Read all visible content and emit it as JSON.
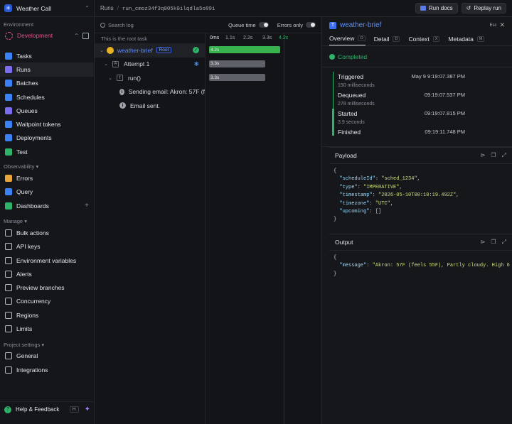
{
  "project": {
    "name": "Weather Call"
  },
  "environment": {
    "section_label": "Environment",
    "name": "Development"
  },
  "nav_main": [
    {
      "label": "Tasks",
      "icon": "tasks-icon",
      "color": "#3b82f6"
    },
    {
      "label": "Runs",
      "icon": "runs-icon",
      "color": "#7c6cf0",
      "active": true
    },
    {
      "label": "Batches",
      "icon": "batches-icon",
      "color": "#3b82f6"
    },
    {
      "label": "Schedules",
      "icon": "schedules-icon",
      "color": "#3b82f6"
    },
    {
      "label": "Queues",
      "icon": "queues-icon",
      "color": "#7c6cf0"
    },
    {
      "label": "Waitpoint tokens",
      "icon": "waitpoint-icon",
      "color": "#3b82f6"
    },
    {
      "label": "Deployments",
      "icon": "deployments-icon",
      "color": "#3b82f6"
    },
    {
      "label": "Test",
      "icon": "test-icon",
      "color": "#2fb36a"
    }
  ],
  "observability": {
    "title": "Observability",
    "items": [
      {
        "label": "Errors",
        "icon": "errors-icon",
        "color": "#e8a53a"
      },
      {
        "label": "Query",
        "icon": "query-icon",
        "color": "#3b82f6"
      },
      {
        "label": "Dashboards",
        "icon": "dashboards-icon",
        "color": "#2fb36a"
      }
    ]
  },
  "manage": {
    "title": "Manage",
    "items": [
      {
        "label": "Bulk actions",
        "icon": "bulk-actions-icon"
      },
      {
        "label": "API keys",
        "icon": "key-icon"
      },
      {
        "label": "Environment variables",
        "icon": "env-vars-icon"
      },
      {
        "label": "Alerts",
        "icon": "bell-icon"
      },
      {
        "label": "Preview branches",
        "icon": "branch-icon"
      },
      {
        "label": "Concurrency",
        "icon": "concurrency-icon"
      },
      {
        "label": "Regions",
        "icon": "globe-icon"
      },
      {
        "label": "Limits",
        "icon": "limits-icon"
      }
    ]
  },
  "project_settings": {
    "title": "Project settings",
    "items": [
      {
        "label": "General",
        "icon": "gear-icon"
      },
      {
        "label": "Integrations",
        "icon": "integrations-icon"
      }
    ]
  },
  "help": {
    "label": "Help & Feedback",
    "shortcut": "H"
  },
  "breadcrumb": {
    "root": "Runs",
    "run_id": "run_cmoz34f3q005k0ilqdla5o89i"
  },
  "top_buttons": {
    "docs": "Run docs",
    "replay": "Replay run"
  },
  "log": {
    "search_placeholder": "Search log",
    "queue_time": "Queue time",
    "errors_only": "Errors only",
    "root_label": "This is the root task",
    "ticks": [
      "0ms",
      "1.1s",
      "2.2s",
      "3.3s",
      "4.2s"
    ],
    "rows": [
      {
        "label": "weather-brief",
        "tag": "Root",
        "duration": "4.2s",
        "progress": 1.0,
        "color": "#37b24d"
      },
      {
        "label": "Attempt 1",
        "duration": "3.3s",
        "progress": 0.79,
        "color": "#5f6168"
      },
      {
        "label": "run()",
        "duration": "3.3s",
        "progress": 0.79,
        "color": "#5f6168"
      },
      {
        "label": "Sending email: Akron: 57F (f"
      },
      {
        "label": "Email sent."
      }
    ]
  },
  "detail": {
    "task_name": "weather-brief",
    "esc_hint": "Esc",
    "tabs": [
      {
        "label": "Overview",
        "key": "O"
      },
      {
        "label": "Detail",
        "key": "D"
      },
      {
        "label": "Context",
        "key": "X"
      },
      {
        "label": "Metadata",
        "key": "M"
      }
    ],
    "status": "Completed",
    "timeline": [
      {
        "label": "Triggered",
        "time": "May 9 9:19:07.387 PM",
        "duration": "150 milliseconds"
      },
      {
        "label": "Dequeued",
        "time": "09:19:07.537 PM",
        "duration": "278 milliseconds"
      },
      {
        "label": "Started",
        "time": "09:19:07.815 PM",
        "duration": "3.9 seconds"
      },
      {
        "label": "Finished",
        "time": "09:19:11.748 PM"
      }
    ],
    "payload_title": "Payload",
    "payload": {
      "scheduleId": "sched_1234",
      "type": "IMPERATIVE",
      "timestamp": "2026-05-10T00:10:19.492Z",
      "timezone": "UTC",
      "upcoming": "[]"
    },
    "output_title": "Output",
    "output": {
      "message": "Akron: 57F (feels 55F), Partly cloudy. High 6"
    }
  }
}
